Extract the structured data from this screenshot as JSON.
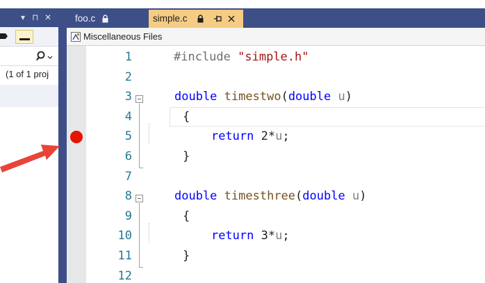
{
  "left_panel": {
    "header_glyphs": [
      "▾",
      "⊓",
      "✕"
    ],
    "project_text": "(1 of 1 proj"
  },
  "tabs": [
    {
      "label": "foo.c",
      "active": false,
      "lock_icon": "lock-icon"
    },
    {
      "label": "simple.c",
      "active": true,
      "lock_icon": "lock-icon",
      "pin_icon": "pin-icon",
      "close_icon": "close-icon"
    }
  ],
  "nav_bar": {
    "label": "Miscellaneous Files",
    "icon": "misc-files-icon"
  },
  "editor": {
    "line_numbers": [
      "1",
      "2",
      "3",
      "4",
      "5",
      "6",
      "7",
      "8",
      "9",
      "10",
      "11",
      "12"
    ],
    "breakpoint_line": 5,
    "lines": [
      {
        "tokens": [
          {
            "t": "#include ",
            "c": "pp"
          },
          {
            "t": "\"simple.h\"",
            "c": "str"
          }
        ]
      },
      {
        "tokens": []
      },
      {
        "tokens": [
          {
            "t": "double",
            "c": "kw"
          },
          {
            "t": " "
          },
          {
            "t": "timestwo",
            "c": "fn"
          },
          {
            "t": "("
          },
          {
            "t": "double",
            "c": "kw"
          },
          {
            "t": " "
          },
          {
            "t": "u",
            "c": "param"
          },
          {
            "t": ")"
          }
        ]
      },
      {
        "tokens": [
          {
            "t": "{"
          }
        ]
      },
      {
        "tokens": [
          {
            "t": "    "
          },
          {
            "t": "return",
            "c": "kw"
          },
          {
            "t": " 2*"
          },
          {
            "t": "u",
            "c": "param"
          },
          {
            "t": ";"
          }
        ]
      },
      {
        "tokens": [
          {
            "t": "}"
          }
        ]
      },
      {
        "tokens": []
      },
      {
        "tokens": [
          {
            "t": "double",
            "c": "kw"
          },
          {
            "t": " "
          },
          {
            "t": "timesthree",
            "c": "fn"
          },
          {
            "t": "("
          },
          {
            "t": "double",
            "c": "kw"
          },
          {
            "t": " "
          },
          {
            "t": "u",
            "c": "param"
          },
          {
            "t": ")"
          }
        ]
      },
      {
        "tokens": [
          {
            "t": "{"
          }
        ]
      },
      {
        "tokens": [
          {
            "t": "    "
          },
          {
            "t": "return",
            "c": "kw"
          },
          {
            "t": " 3*"
          },
          {
            "t": "u",
            "c": "param"
          },
          {
            "t": ";"
          }
        ]
      },
      {
        "tokens": [
          {
            "t": "}"
          }
        ]
      },
      {
        "tokens": []
      }
    ]
  },
  "colors": {
    "chrome": "#3d4f86",
    "active_tab": "#f5cc84",
    "breakpoint": "#e51400",
    "line_number": "#237893",
    "keyword": "#0000ff",
    "string": "#a31515",
    "arrow": "#e8443a"
  }
}
